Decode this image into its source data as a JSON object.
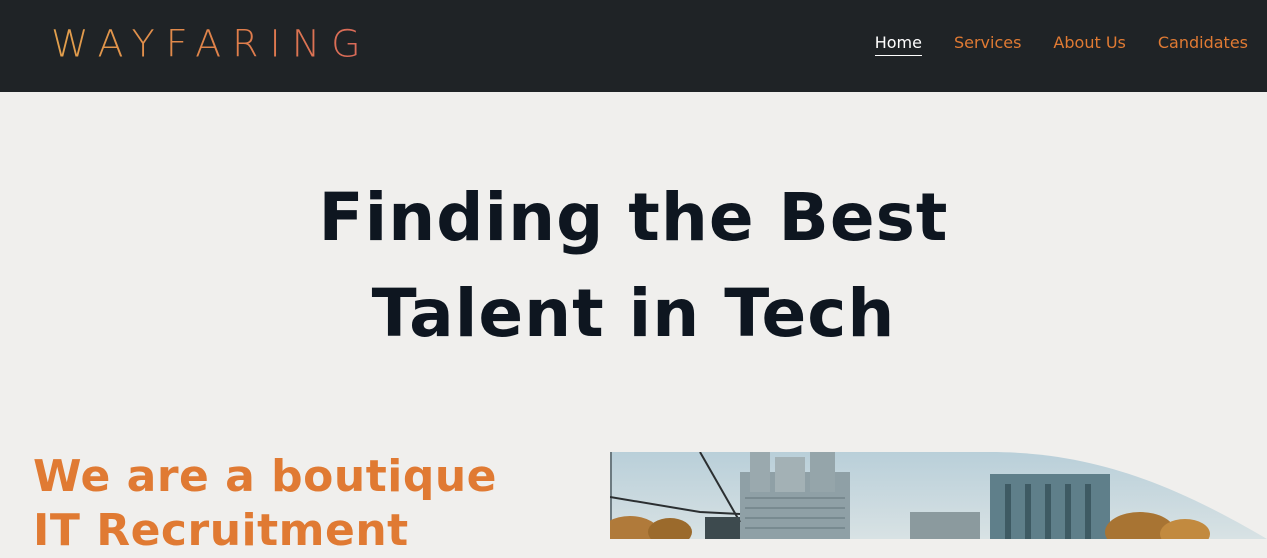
{
  "header": {
    "logo_text": "WAYFARING",
    "nav": [
      {
        "label": "Home",
        "active": true
      },
      {
        "label": "Services",
        "active": false
      },
      {
        "label": "About Us",
        "active": false
      },
      {
        "label": "Candidates",
        "active": false
      }
    ]
  },
  "hero": {
    "title_line1": "Finding the Best",
    "title_line2": "Talent in Tech"
  },
  "intro": {
    "line1": "We are a boutique",
    "line2": "IT Recruitment"
  },
  "colors": {
    "header_bg": "#1f2326",
    "page_bg": "#f0efed",
    "accent": "#e07a33",
    "title": "#0e1620"
  }
}
